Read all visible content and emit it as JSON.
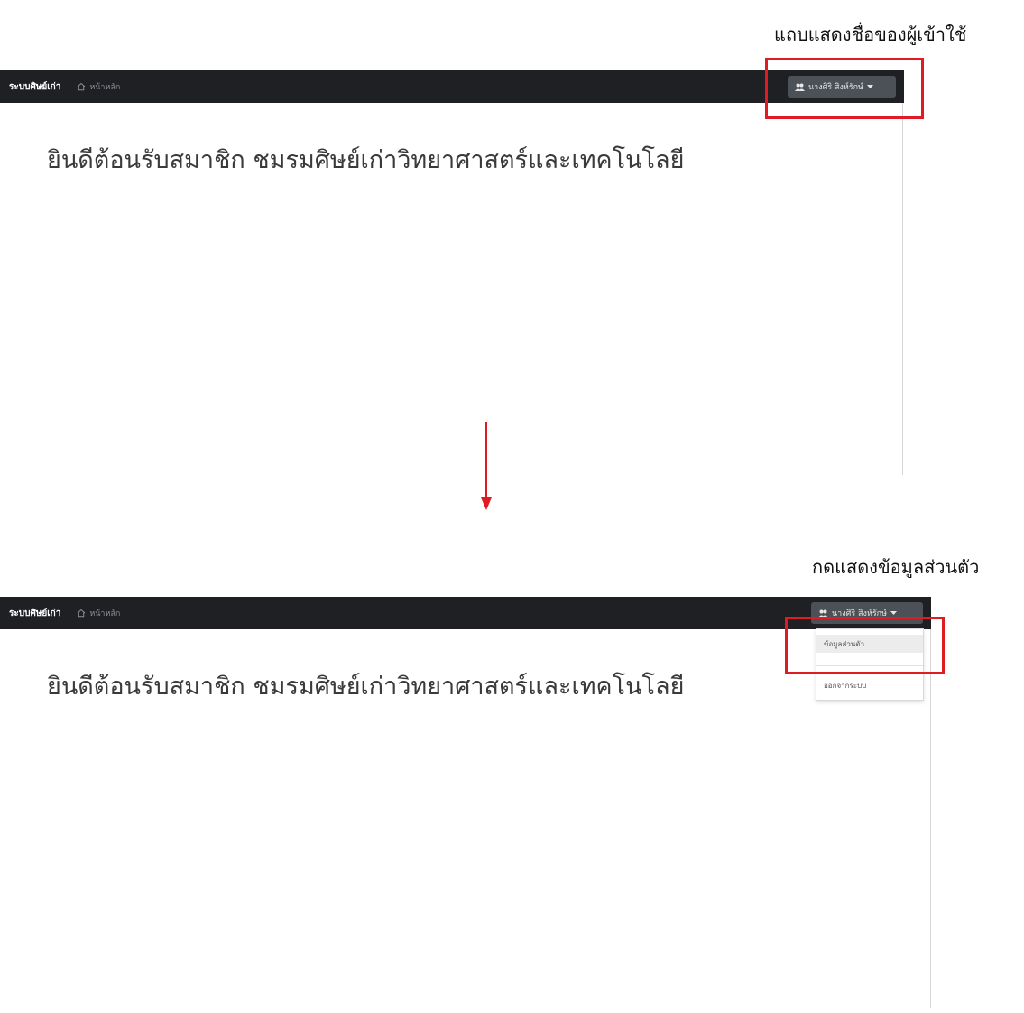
{
  "captions": {
    "top": "แถบแสดงชื่อของผู้เข้าใช้",
    "bottom": "กดแสดงข้อมูลส่วนตัว"
  },
  "navbar": {
    "brand": "ระบบศิษย์เก่า",
    "home_label": "หน้าหลัก",
    "user_name": "นางศิริ สิงห์รักษ์"
  },
  "main": {
    "welcome": "ยินดีต้อนรับสมาชิก ชมรมศิษย์เก่าวิทยาศาสตร์และเทคโนโลยี"
  },
  "dropdown": {
    "items": [
      {
        "label": "ข้อมูลส่วนตัว"
      },
      {
        "label": "ออกจากระบบ"
      }
    ]
  },
  "colors": {
    "navbar_bg": "#1f2024",
    "highlight": "#e01b24",
    "arrow": "#e01b24"
  }
}
